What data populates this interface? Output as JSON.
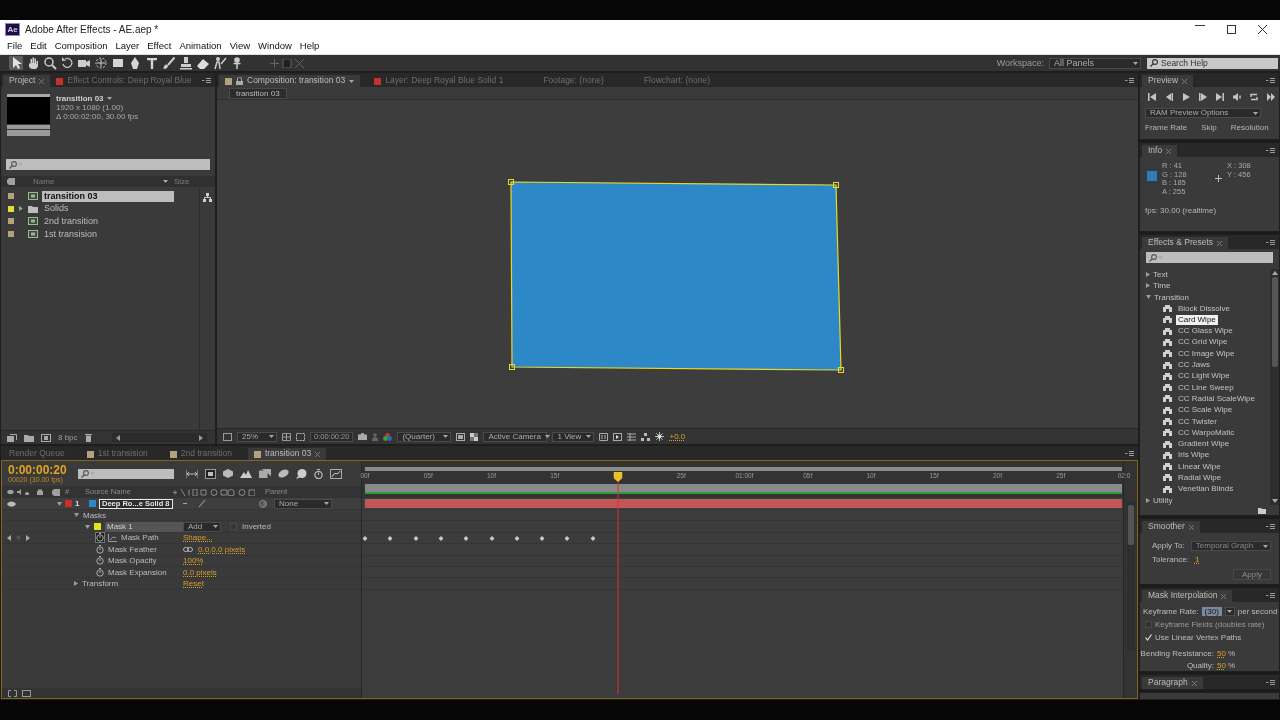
{
  "window": {
    "logo": "Ae",
    "title": "Adobe After Effects - AE.aep *"
  },
  "menu": [
    "File",
    "Edit",
    "Composition",
    "Layer",
    "Effect",
    "Animation",
    "View",
    "Window",
    "Help"
  ],
  "toolbar": {
    "tools": [
      {
        "kind": "select",
        "selected": true
      },
      {
        "kind": "hand",
        "selected": false
      },
      {
        "kind": "zoom",
        "selected": false
      },
      {
        "kind": "rotate",
        "selected": false
      },
      {
        "kind": "camera",
        "selected": false
      },
      {
        "kind": "pan",
        "selected": false
      },
      {
        "kind": "rectangle",
        "selected": false
      },
      {
        "kind": "pen",
        "selected": false
      },
      {
        "kind": "text",
        "selected": false
      },
      {
        "kind": "brush",
        "selected": false
      },
      {
        "kind": "stamp",
        "selected": false
      },
      {
        "kind": "eraser",
        "selected": false
      },
      {
        "kind": "roto",
        "selected": false
      },
      {
        "kind": "pin",
        "selected": false
      }
    ],
    "workspace_label": "Workspace:",
    "workspace": "All Panels",
    "search": {
      "placeholder": "Search Help"
    }
  },
  "project_panel": {
    "tabs": [
      {
        "kind": "project",
        "label": "Project",
        "selected": true
      },
      {
        "kind": "effects",
        "label": "Effect Controls: Deep Royal Blue",
        "selected": false
      }
    ],
    "summary": {
      "name": "transition 03",
      "size": "1920 x 1080 (1.00)",
      "duration": "Δ 0:00:02:00, 30.00 fps"
    },
    "columns": [
      "Name",
      "Size"
    ],
    "items": [
      {
        "kind": "comp",
        "name": "transition 03",
        "color": "#b3a27c",
        "selected": true
      },
      {
        "kind": "folder",
        "name": "Solids",
        "color": "#e2dc3a",
        "expanded": false,
        "selected": false
      },
      {
        "kind": "comp",
        "name": "2nd transition",
        "color": "#b3a27c",
        "selected": false
      },
      {
        "kind": "comp",
        "name": "1st transision",
        "color": "#b3a27c",
        "selected": false
      }
    ],
    "bit_depth": "8 bpc"
  },
  "composition_panel": {
    "tabs": [
      {
        "kind": "composition",
        "label": "Composition: transition 03",
        "selected": true
      },
      {
        "kind": "layer",
        "label": "Layer: Deep Royal Blue Solid 1",
        "selected": false
      },
      {
        "kind": "footage",
        "label": "Footage: (none)",
        "selected": false
      },
      {
        "kind": "flowchart",
        "label": "Flowchart: (none)",
        "selected": false
      }
    ],
    "breadcrumb": "transition 03",
    "controls": {
      "zoom": "25%",
      "timecode": "0:00:00:20",
      "resolution": "(Quarter)",
      "camera": "Active Camera",
      "views": "1 View",
      "exposure": "+0.0"
    }
  },
  "preview_panel": {
    "title": "Preview",
    "ram_options": "RAM Preview Options",
    "labels": [
      "Frame Rate",
      "Skip",
      "Resolution"
    ]
  },
  "info_panel": {
    "title": "Info",
    "readings": [
      "R : 41",
      "G : 128",
      "B : 185",
      "A : 255"
    ],
    "position": [
      "X : 308",
      "Y : 456"
    ],
    "fps": "fps: 30.00 (realtime)"
  },
  "effects_presets_panel": {
    "title": "Effects & Presets",
    "tree": [
      {
        "label": "Text",
        "expanded": false
      },
      {
        "label": "Time",
        "expanded": false
      },
      {
        "label": "Transition",
        "expanded": true,
        "children": [
          {
            "label": "Block Dissolve",
            "selected": false
          },
          {
            "label": "Card Wipe",
            "selected": true
          },
          {
            "label": "CC Glass Wipe",
            "selected": false
          },
          {
            "label": "CC Grid Wipe",
            "selected": false
          },
          {
            "label": "CC Image Wipe",
            "selected": false
          },
          {
            "label": "CC Jaws",
            "selected": false
          },
          {
            "label": "CC Light Wipe",
            "selected": false
          },
          {
            "label": "CC Line Sweep",
            "selected": false
          },
          {
            "label": "CC Radial ScaleWipe",
            "selected": false
          },
          {
            "label": "CC Scale Wipe",
            "selected": false
          },
          {
            "label": "CC Twister",
            "selected": false
          },
          {
            "label": "CC WarpoMatic",
            "selected": false
          },
          {
            "label": "Gradient Wipe",
            "selected": false
          },
          {
            "label": "Iris Wipe",
            "selected": false
          },
          {
            "label": "Linear Wipe",
            "selected": false
          },
          {
            "label": "Radial Wipe",
            "selected": false
          },
          {
            "label": "Venetian Blinds",
            "selected": false
          }
        ]
      },
      {
        "label": "Utility",
        "expanded": false
      }
    ]
  },
  "smoother_panel": {
    "title": "Smoother",
    "apply_to": {
      "label": "Apply To:",
      "value": "Temporal Graph",
      "disabled": true
    },
    "tolerance": {
      "label": "Tolerance:",
      "value": "1"
    },
    "apply_button": {
      "label": "Apply",
      "disabled": true
    }
  },
  "mask_interpolation_panel": {
    "title": "Mask Interpolation",
    "keyframe_rate": {
      "label": "Keyframe Rate:",
      "value": "(30)",
      "unit": "per second"
    },
    "options": [
      {
        "label": "Keyframe Fields (doubles rate)",
        "checked": false
      },
      {
        "label": "Use Linear Vertex Paths",
        "checked": true
      }
    ],
    "settings": [
      {
        "label": "Bending Resistance:",
        "value": "50",
        "unit": "%"
      },
      {
        "label": "Quality:",
        "value": "50",
        "unit": "%"
      }
    ]
  },
  "paragraph_panel": {
    "title": "Paragraph"
  },
  "timeline": {
    "tabs": [
      {
        "kind": "queue",
        "label": "Render Queue",
        "selected": false
      },
      {
        "kind": "comp",
        "label": "1st transision",
        "selected": false
      },
      {
        "kind": "comp",
        "label": "2nd transition",
        "selected": false
      },
      {
        "kind": "comp",
        "label": "transition 03",
        "selected": true
      }
    ],
    "timecode": "0:00:00:20",
    "frame_rate": "00020 (30.00 fps)",
    "columns": {
      "number": "#",
      "source": "Source Name",
      "parent": "Parent"
    },
    "layer": {
      "number": "1",
      "name": "Deep Ro...e Solid 8",
      "color": "#c8302c",
      "parent": "None",
      "expanded": true,
      "children": [
        {
          "kind": "group",
          "label": "Masks",
          "expanded": true,
          "children": [
            {
              "kind": "mask",
              "label": "Mask 1",
              "color": "#e6e21a",
              "mode": "Add",
              "inverted": false,
              "inverted_label": "Inverted",
              "expanded": true,
              "children": [
                {
                  "kind": "shape",
                  "label": "Mask Path",
                  "value": "Shape...",
                  "animated": true,
                  "keyframes": [
                    {
                      "level": 0
                    },
                    {
                      "level": 0.0333
                    },
                    {
                      "level": 0.0667
                    },
                    {
                      "level": 0.1
                    },
                    {
                      "level": 0.1333
                    },
                    {
                      "level": 0.1667
                    },
                    {
                      "level": 0.2
                    },
                    {
                      "level": 0.2333
                    },
                    {
                      "level": 0.2667
                    },
                    {
                      "level": 0.3
                    }
                  ]
                },
                {
                  "kind": "vector",
                  "label": "Mask Feather",
                  "value": "0.0,0.0 pixels",
                  "animated": false
                },
                {
                  "kind": "scalar",
                  "label": "Mask Opacity",
                  "value": "100%",
                  "animated": false
                },
                {
                  "kind": "scalar",
                  "label": "Mask Expansion",
                  "value": "0.0 pixels",
                  "animated": false
                }
              ]
            }
          ]
        },
        {
          "kind": "group",
          "label": "Transform",
          "expanded": false,
          "value": "Reset"
        }
      ]
    },
    "ruler": [
      {
        "label": "00f",
        "level": 0
      },
      {
        "label": "05f",
        "level": 0.0833
      },
      {
        "label": "10f",
        "level": 0.1667
      },
      {
        "label": "15f",
        "level": 0.25
      },
      {
        "label": "25f",
        "level": 0.4167
      },
      {
        "label": "01:00f",
        "level": 0.5
      },
      {
        "label": "05f",
        "level": 0.5833
      },
      {
        "label": "10f",
        "level": 0.6667
      },
      {
        "label": "15f",
        "level": 0.75
      },
      {
        "label": "20f",
        "level": 0.8333
      },
      {
        "label": "25f",
        "level": 0.9167
      },
      {
        "label": "02:0",
        "level": 1
      }
    ],
    "playhead": {
      "level": 0.3333
    }
  }
}
